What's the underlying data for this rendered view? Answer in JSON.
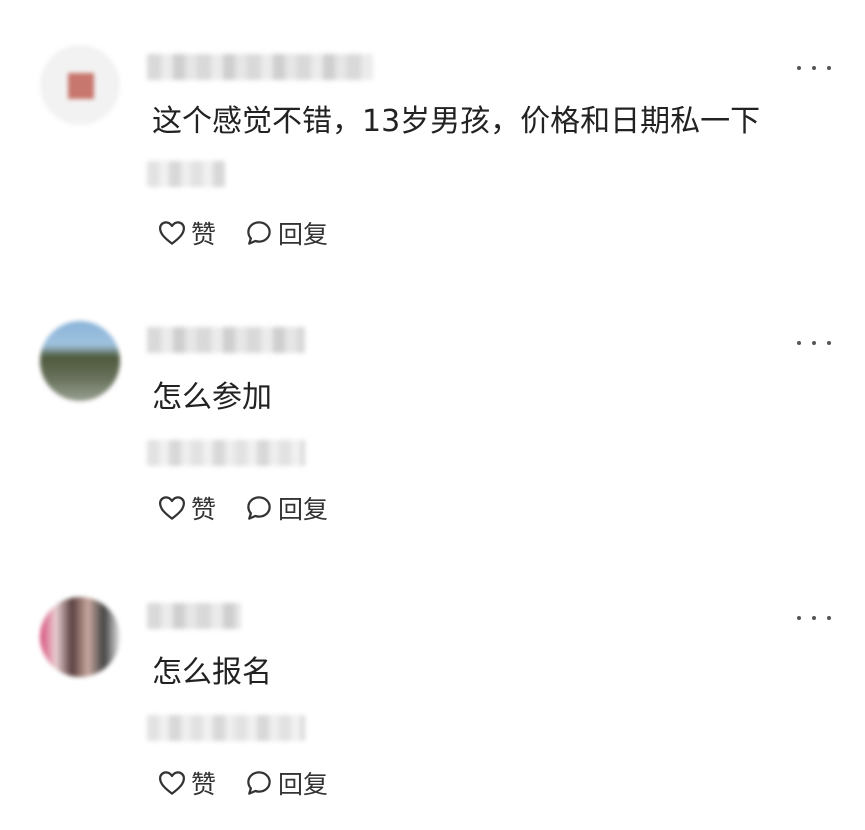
{
  "comments": [
    {
      "text": "这个感觉不错，13岁男孩，价格和日期私一下",
      "like_label": "赞",
      "reply_label": "回复",
      "like_icon": "heart-outline-icon",
      "reply_icon": "speech-bubble-icon",
      "more_icon": "more-dots-icon"
    },
    {
      "text": "怎么参加",
      "like_label": "赞",
      "reply_label": "回复",
      "like_icon": "heart-outline-icon",
      "reply_icon": "speech-bubble-icon",
      "more_icon": "more-dots-icon"
    },
    {
      "text": "怎么报名",
      "like_label": "赞",
      "reply_label": "回复",
      "like_icon": "heart-outline-icon",
      "reply_icon": "speech-bubble-icon",
      "more_icon": "more-dots-icon"
    }
  ],
  "colors": {
    "text": "#222222",
    "action_text": "#333333",
    "icon": "#333333",
    "background": "#ffffff"
  }
}
